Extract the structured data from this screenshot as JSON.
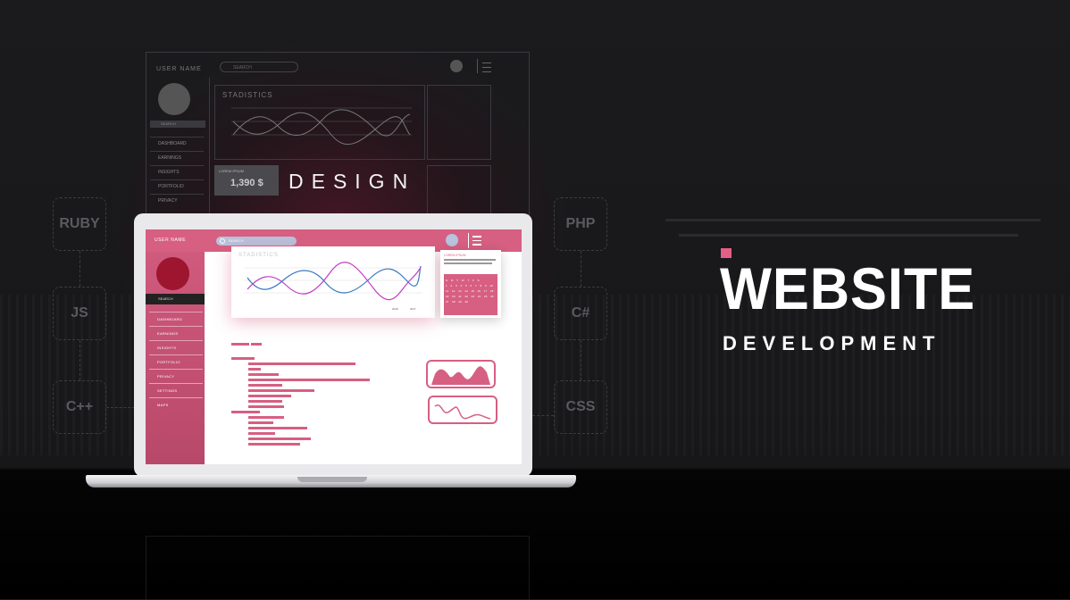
{
  "background_dashboard": {
    "user_label": "USER NAME",
    "search_placeholder": "SEARCH",
    "sidebar_search": "SEARCH",
    "sidebar_items": [
      "DASHBOARD",
      "EARNINGS",
      "INSIGHTS",
      "PORTFOLIO",
      "PRIVACY"
    ],
    "stats_title": "STADISTICS",
    "price": "1,390 $",
    "price_label": "LOREM IPSUM"
  },
  "design_label": "DESIGN",
  "tech_labels": {
    "ruby": "RUBY",
    "js": "JS",
    "cpp": "C++",
    "php": "PHP",
    "csharp": "C#",
    "css": "CSS"
  },
  "laptop_screen": {
    "user_label": "USER NAME",
    "search_placeholder": "SEARCH",
    "sidebar_search": "SEARCH",
    "sidebar_items": [
      "DASHBOARD",
      "EARNINGS",
      "INSIGHTS",
      "PORTFOLIO",
      "PRIVACY",
      "SETTINGS",
      "MAPS"
    ],
    "stats_title": "STADISTICS",
    "calendar_title": "LOREM IPSUM",
    "calendar_weekdays": "S M T W T F S",
    "calendar_days": "1 2 3 4 5 6 7 8 9 10 11 12 13 14 15 16 17 18 19 20 21 22 23 24 25 26 27 28 29 30",
    "legend_a": "2016",
    "legend_b": "2017"
  },
  "headline": {
    "title": "WEBSITE",
    "subtitle": "DEVELOPMENT"
  },
  "colors": {
    "accent": "#d75f82",
    "background": "#1b1b1d",
    "headline": "#ffffff"
  },
  "icons": [
    "search-icon",
    "menu-icon",
    "avatar"
  ]
}
